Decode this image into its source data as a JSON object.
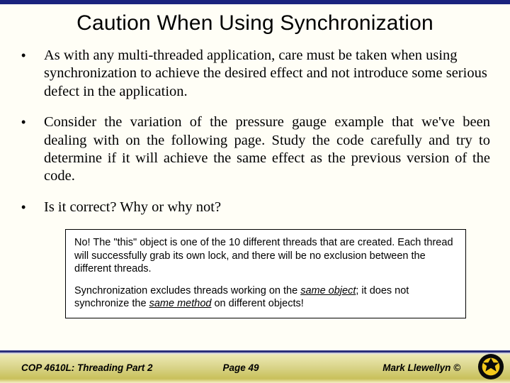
{
  "title": "Caution When Using Synchronization",
  "bullets": [
    "As with any multi-threaded application, care must be taken when using synchronization to achieve the desired effect and not introduce some serious defect in the application.",
    "Consider the variation of the pressure gauge example that we've been dealing with on the following page.  Study the code carefully and try to determine if it will achieve the same effect as the previous version of the code.",
    "Is it correct?  Why or why not?"
  ],
  "note": {
    "p1": "No!  The \"this\" object is one of the 10 different threads that are created.  Each thread will successfully grab its own lock, and there will be no exclusion between the different threads.",
    "p2_pre": "Synchronization excludes threads working on the ",
    "p2_em1": "same object",
    "p2_mid": "; it does not synchronize the ",
    "p2_em2": "same method",
    "p2_post": " on different objects!"
  },
  "footer": {
    "left": "COP 4610L: Threading Part 2",
    "center": "Page 49",
    "right": "Mark Llewellyn ©"
  }
}
